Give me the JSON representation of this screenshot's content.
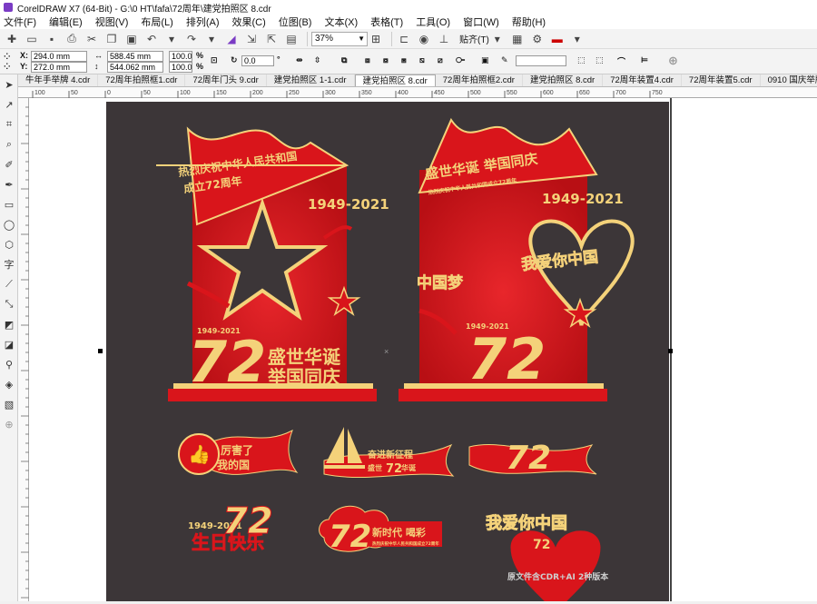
{
  "window": {
    "title": "CorelDRAW X7 (64-Bit) - G:\\0 HT\\fafa\\72周年\\建党拍照区 8.cdr"
  },
  "menu": [
    "文件(F)",
    "编辑(E)",
    "视图(V)",
    "布局(L)",
    "排列(A)",
    "效果(C)",
    "位图(B)",
    "文本(X)",
    "表格(T)",
    "工具(O)",
    "窗口(W)",
    "帮助(H)"
  ],
  "toolbar": {
    "zoom": "37%",
    "snap_label": "贴齐(T)"
  },
  "properties": {
    "x": "294.0 mm",
    "y": "272.0 mm",
    "w": "588.45 mm",
    "h": "544.062 mm",
    "sx": "100.0",
    "sy": "100.0",
    "pct": "%",
    "angle": "0.0",
    "deg": "°",
    "x_label": "X:",
    "y_label": "Y:"
  },
  "tabs": [
    "牛年手举牌 4.cdr",
    "72周年拍照框1.cdr",
    "72周年门头 9.cdr",
    "建党拍照区 1-1.cdr",
    "建党拍照区 8.cdr",
    "72周年拍照框2.cdr",
    "建党拍照区 8.cdr",
    "72周年装置4.cdr",
    "72周年装置5.cdr",
    "0910 国庆举牌1.cdr"
  ],
  "active_tab_index": 4,
  "ruler": {
    "h_ticks": [
      "100",
      "50",
      "0",
      "50",
      "100",
      "150",
      "200",
      "250",
      "300",
      "350",
      "400",
      "450",
      "500",
      "550",
      "600",
      "650",
      "700",
      "750"
    ]
  },
  "artwork": {
    "left_board": {
      "title1": "热烈庆祝中华人民共和国",
      "title2": "成立72周年",
      "years": "1949-2021",
      "number": "72",
      "slogan1": "盛世华诞",
      "slogan2": "举国同庆",
      "mini_years": "1949-2021"
    },
    "right_board": {
      "title": "盛世华诞  举国同庆",
      "subtitle": "热烈庆祝中华人民共和国成立72周年",
      "years": "1949-2021",
      "dream": "中国梦",
      "love": "我爱你中国",
      "number": "72",
      "mini_years": "1949-2021"
    },
    "badges": {
      "b1": "厉害了我的国",
      "b1a": "厉害了",
      "b1b": "我的国",
      "b2a": "奋进新征程",
      "b2b": "盛世",
      "b2c": "华诞",
      "b2num": "72",
      "b3num": "72",
      "b4years": "1949-2021",
      "b4num": "72",
      "b4text": "生日快乐",
      "b5num": "72",
      "b5text": "新时代 喝彩",
      "b5sub": "热烈庆祝中华人民共和国成立72周年",
      "b6text": "我爱你中国",
      "b6num": "72"
    },
    "note": "原文件含CDR+AI 2种版本"
  },
  "colors": {
    "red": "#d9151b",
    "gold": "#f4d27a",
    "bg": "#3c3638"
  }
}
